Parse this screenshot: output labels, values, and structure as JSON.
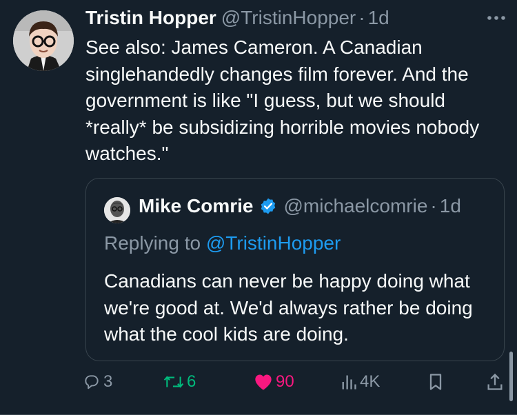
{
  "tweet": {
    "author": {
      "display_name": "Tristin Hopper",
      "handle": "@TristinHopper",
      "separator": "·",
      "time": "1d"
    },
    "text": "See also: James Cameron. A Canadian singlehandedly changes film forever. And the government is like \"I guess, but we should *really* be subsidizing horrible movies nobody watches.\"",
    "more_icon": "more-horizontal-icon"
  },
  "quote": {
    "author": {
      "display_name": "Mike Comrie",
      "verified": true,
      "handle": "@michaelcomrie",
      "separator": "·",
      "time": "1d"
    },
    "replying_prefix": "Replying to ",
    "replying_to": "@TristinHopper",
    "text": "Canadians can never be happy doing what we're good at. We'd always rather be doing what the cool kids are doing."
  },
  "actions": {
    "reply": {
      "icon": "reply-icon",
      "count": "3"
    },
    "retweet": {
      "icon": "retweet-icon",
      "count": "6",
      "color": "#00ba7c"
    },
    "like": {
      "icon": "heart-icon",
      "count": "90",
      "color": "#f91880"
    },
    "views": {
      "icon": "views-icon",
      "count": "4K"
    },
    "bookmark": {
      "icon": "bookmark-icon"
    },
    "share": {
      "icon": "share-icon"
    }
  },
  "colors": {
    "background": "#15202b",
    "text": "#f7f9f9",
    "muted": "#8b98a5",
    "accent": "#1d9bf0",
    "border": "#38444d"
  }
}
